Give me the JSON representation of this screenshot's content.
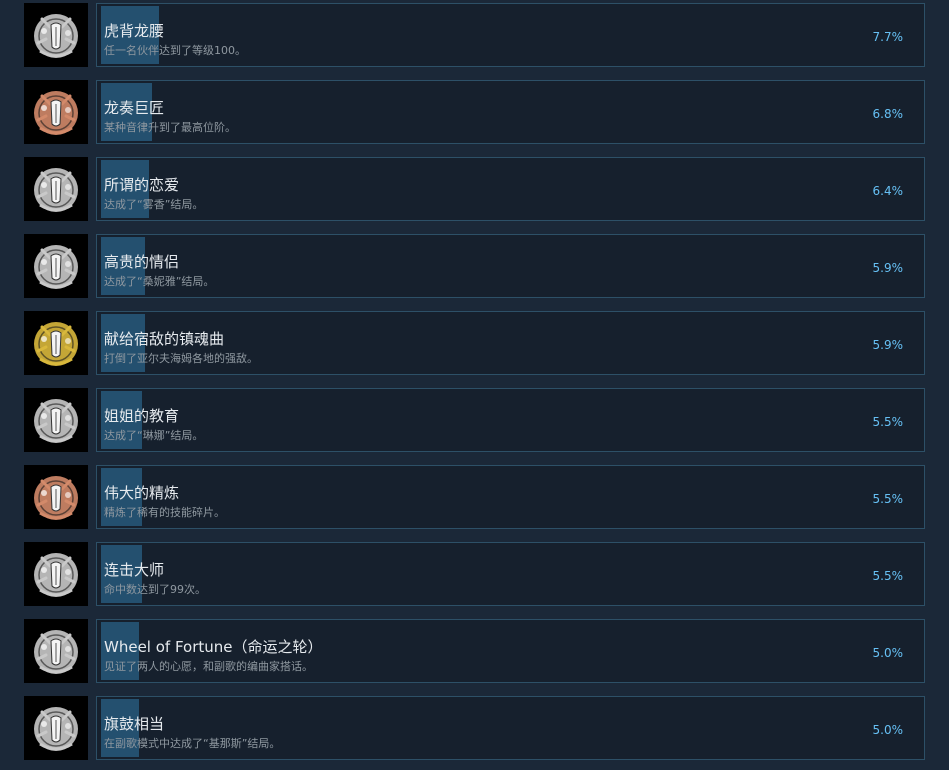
{
  "achievements": [
    {
      "name": "虎背龙腰",
      "description": "任一名伙伴达到了等级100。",
      "percent_label": "7.7%",
      "percent": 7.7,
      "icon": "crest-silver-icon",
      "icon_color": "#c9c9c9"
    },
    {
      "name": "龙奏巨匠",
      "description": "某种音律升到了最高位阶。",
      "percent_label": "6.8%",
      "percent": 6.8,
      "icon": "crest-bronze-icon",
      "icon_color": "#d38a6a"
    },
    {
      "name": "所谓的恋爱",
      "description": "达成了“雾香”结局。",
      "percent_label": "6.4%",
      "percent": 6.4,
      "icon": "crest-silver-icon",
      "icon_color": "#c9c9c9"
    },
    {
      "name": "高贵的情侣",
      "description": "达成了“桑妮雅”结局。",
      "percent_label": "5.9%",
      "percent": 5.9,
      "icon": "crest-silver-icon",
      "icon_color": "#c9c9c9"
    },
    {
      "name": "献给宿敌的镇魂曲",
      "description": "打倒了亚尔夫海姆各地的强敌。",
      "percent_label": "5.9%",
      "percent": 5.9,
      "icon": "crest-gold-icon",
      "icon_color": "#d9b83c"
    },
    {
      "name": "姐姐的教育",
      "description": "达成了“琳娜”结局。",
      "percent_label": "5.5%",
      "percent": 5.5,
      "icon": "crest-silver-icon",
      "icon_color": "#c9c9c9"
    },
    {
      "name": "伟大的精炼",
      "description": "精炼了稀有的技能碎片。",
      "percent_label": "5.5%",
      "percent": 5.5,
      "icon": "crest-bronze-icon",
      "icon_color": "#d38a6a"
    },
    {
      "name": "连击大师",
      "description": "命中数达到了99次。",
      "percent_label": "5.5%",
      "percent": 5.5,
      "icon": "crest-silver-icon",
      "icon_color": "#c9c9c9"
    },
    {
      "name": "Wheel of Fortune（命运之轮）",
      "description": "见证了两人的心愿，和副歌的编曲家搭话。",
      "percent_label": "5.0%",
      "percent": 5.0,
      "icon": "crest-silver-icon",
      "icon_color": "#c9c9c9"
    },
    {
      "name": "旗鼓相当",
      "description": "在副歌模式中达成了“基那斯”结局。",
      "percent_label": "5.0%",
      "percent": 5.0,
      "icon": "crest-silver-icon",
      "icon_color": "#c9c9c9"
    }
  ]
}
